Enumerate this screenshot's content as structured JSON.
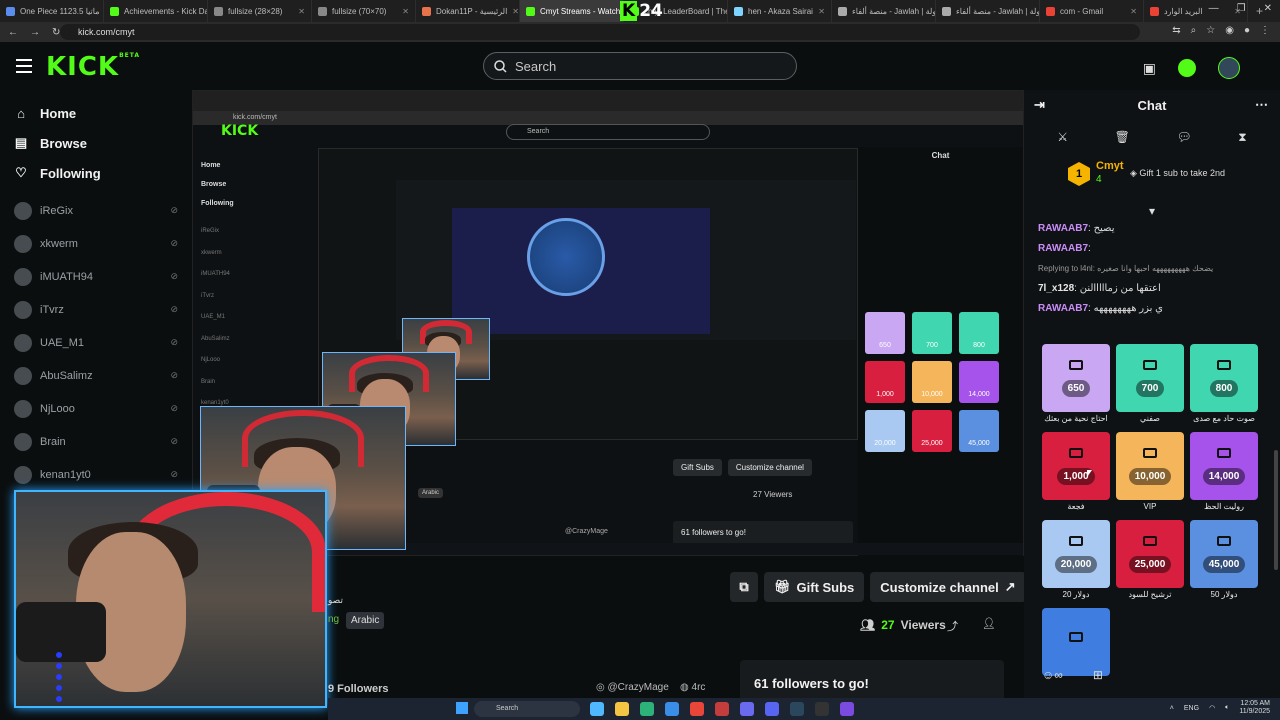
{
  "browser": {
    "tabs": [
      {
        "label": "One Piece 1123.5 ماتيا",
        "color": "#5b8def"
      },
      {
        "label": "Achievements - Kick Dash",
        "color": "#53fc18"
      },
      {
        "label": "fullsize (28×28)",
        "color": "#888888"
      },
      {
        "label": "fullsize (70×70)",
        "color": "#888888"
      },
      {
        "label": "Dokan11P - الرئيسية",
        "color": "#e6734a"
      },
      {
        "label": "Cmyt Streams - Watch L",
        "color": "#53fc18",
        "active": true
      },
      {
        "label": "cmyt LeaderBoard | The b",
        "color": "#53fc18"
      },
      {
        "label": "hen - Akaza Sairai",
        "color": "#7fd3ff"
      },
      {
        "label": "منصة ألفاء - Jawlah | جولة",
        "color": "#aaaaaa"
      },
      {
        "label": "منصة ألفاء - Jawlah | جولة",
        "color": "#aaaaaa"
      },
      {
        "label": "com - Gmail",
        "color": "#ea4335"
      },
      {
        "label": "البريد الوارد",
        "color": "#ea4335"
      }
    ],
    "tab_overlay": "24",
    "url": "kick.com/cmyt"
  },
  "header": {
    "logo": "KICK",
    "logo_tag": "BETA",
    "search_placeholder": "Search"
  },
  "sidebar": {
    "nav": [
      {
        "label": "Home",
        "icon": "home-icon"
      },
      {
        "label": "Browse",
        "icon": "browse-icon"
      },
      {
        "label": "Following",
        "icon": "heart-icon"
      }
    ],
    "channels": [
      "iReGix",
      "xkwerm",
      "iMUATH94",
      "iTvrz",
      "UAE_M1",
      "AbuSalimz",
      "NjLooo",
      "Brain",
      "kenan1yt0"
    ]
  },
  "stream": {
    "actions": {
      "gift_subs": "Gift Subs",
      "customize": "Customize channel"
    },
    "viewers_count": "27",
    "viewers_label": "Viewers",
    "language": "Arabic",
    "category_partial": "ng",
    "title_partial": "تصو",
    "followers_label": "9 Followers",
    "social_handle": "@CrazyMage",
    "discord_label": "4rc",
    "goal": "61 followers to go!"
  },
  "nested": {
    "chat_title": "Chat",
    "search": "Search",
    "nav": [
      "Home",
      "Browse",
      "Following"
    ],
    "rewards_mini": [
      "650",
      "700",
      "800",
      "1,000",
      "10,000",
      "14,000",
      "20,000",
      "25,000",
      "45,000"
    ],
    "viewers": "27 Viewers",
    "goal": "61 followers to go!",
    "arabic": "Arabic",
    "mage": "@CrazyMage",
    "gift_subs": "Gift Subs",
    "customize": "Customize channel"
  },
  "chat": {
    "title": "Chat",
    "pinned": {
      "name": "Cmyt",
      "sub_count": "4",
      "gift_text": "Gift 1 sub to take 2nd",
      "rank": "1"
    },
    "messages": [
      {
        "user": "RAWAAB7",
        "text": "يصيح"
      },
      {
        "user": "RAWAAB7",
        "text": ""
      },
      {
        "reply": "Replying to l4nl: يضحك هههههههههه احبها وانا صغيره"
      },
      {
        "user": "7l_x128",
        "text": "اعتقها من زمااااالنن"
      },
      {
        "user": "RAWAAB7",
        "text": "ي بزر ههههههههه"
      }
    ],
    "rewards": [
      {
        "cost": "650",
        "label": "احتاج نحية من بعثك",
        "color": "#c9a7f2"
      },
      {
        "cost": "700",
        "label": "صفني",
        "color": "#3fd6b0"
      },
      {
        "cost": "800",
        "label": "صوت حاد مع صدى",
        "color": "#3fd6b0"
      },
      {
        "cost": "1,000",
        "label": "فجعة",
        "color": "#d91f3f"
      },
      {
        "cost": "10,000",
        "label": "VIP",
        "color": "#f5b55a"
      },
      {
        "cost": "14,000",
        "label": "روليت الحظ",
        "color": "#a553ea"
      },
      {
        "cost": "20,000",
        "label": "دولار 20",
        "color": "#a9c9f2"
      },
      {
        "cost": "25,000",
        "label": "ترشيح للسود",
        "color": "#d91f3f"
      },
      {
        "cost": "45,000",
        "label": "دولار 50",
        "color": "#5b8fe0"
      },
      {
        "cost": "",
        "label": "",
        "color": "#3f7de0"
      }
    ]
  },
  "taskbar": {
    "search": "Search",
    "lang": "ENG",
    "time": "12:05 AM",
    "date": "11/9/2025"
  }
}
